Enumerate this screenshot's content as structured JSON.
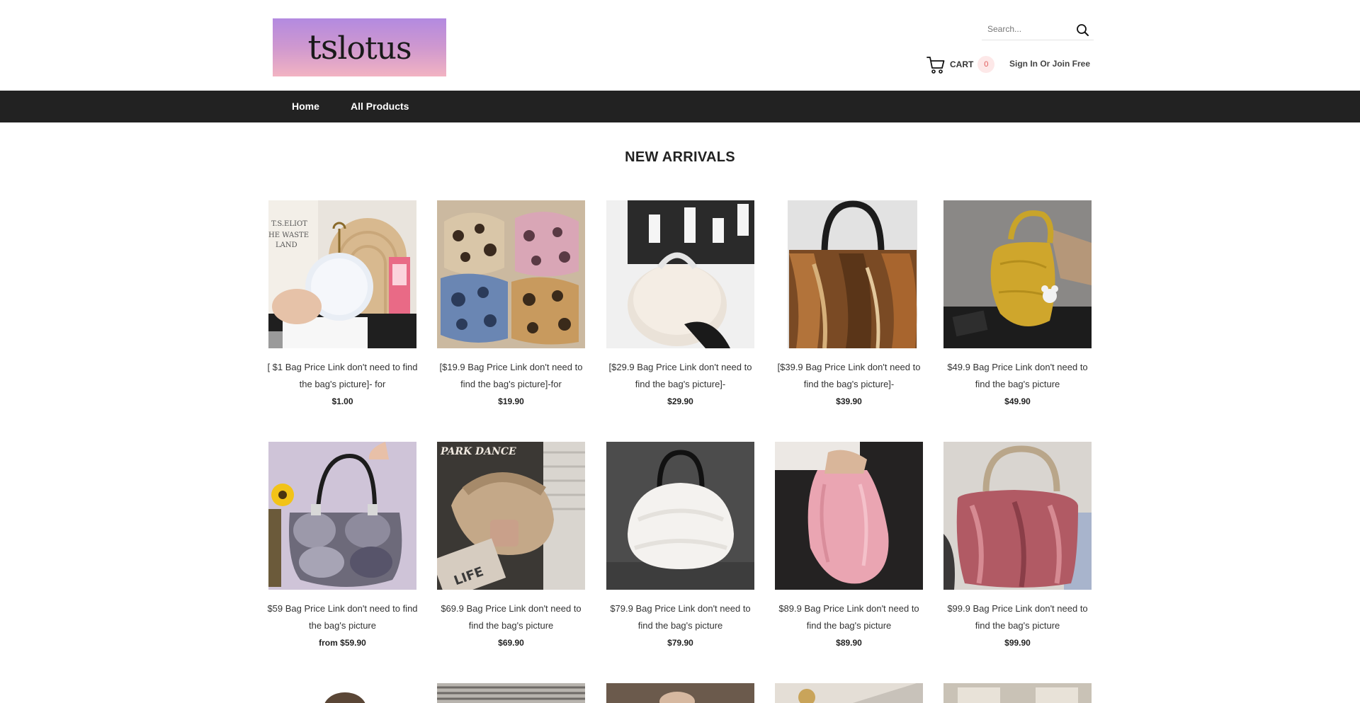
{
  "logo": {
    "text_ts": "ts",
    "text_rest": "lotus"
  },
  "search": {
    "placeholder": "Search..."
  },
  "cart": {
    "label": "CART",
    "count": "0"
  },
  "signin": {
    "label": "Sign In Or Join Free"
  },
  "nav": {
    "items": [
      "Home",
      "All Products"
    ]
  },
  "section": {
    "title": "NEW ARRIVALS"
  },
  "products": [
    {
      "title": "[ $1 Bag Price Link don't need to find the bag's picture]- for",
      "price": "$1.00"
    },
    {
      "title": "[$19.9 Bag Price Link don't need to find the bag's picture]-for",
      "price": "$19.90"
    },
    {
      "title": "[$29.9 Bag Price Link don't need to find the bag's picture]-",
      "price": "$29.90"
    },
    {
      "title": "[$39.9 Bag Price Link don't need to find the bag's picture]-",
      "price": "$39.90"
    },
    {
      "title": "$49.9 Bag Price Link don't need to find the bag's picture",
      "price": "$49.90"
    },
    {
      "title": "$59 Bag Price Link don't need to find the bag's picture",
      "price": "from $59.90"
    },
    {
      "title": "$69.9 Bag Price Link don't need to find the bag's picture",
      "price": "$69.90"
    },
    {
      "title": "$79.9 Bag Price Link don't need to find the bag's picture",
      "price": "$79.90"
    },
    {
      "title": "$89.9 Bag Price Link don't need to find the bag's picture",
      "price": "$89.90"
    },
    {
      "title": "$99.9 Bag Price Link don't need to find the bag's picture",
      "price": "$99.90"
    }
  ],
  "image_text": {
    "book_line1": "T.S.ELIOT",
    "book_line2": "HE WASTE",
    "book_line3": "LAND",
    "brand_overlay": "PARK DANCE",
    "tag_text": "LIFE"
  }
}
